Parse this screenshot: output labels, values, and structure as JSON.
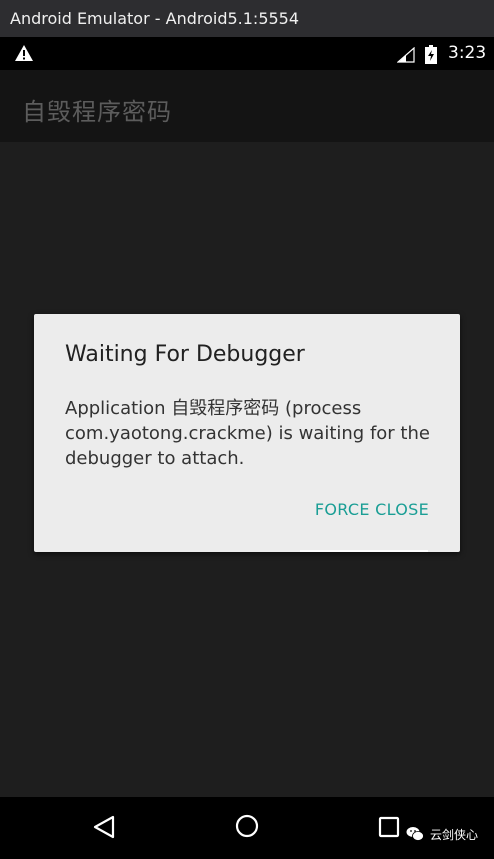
{
  "window": {
    "title": "Android Emulator - Android5.1:5554"
  },
  "status_bar": {
    "time": "3:23",
    "icons": [
      "warning-icon",
      "signal-icon",
      "battery-icon"
    ]
  },
  "app_bar": {
    "title": "自毁程序密码"
  },
  "dialog": {
    "title": "Waiting For Debugger",
    "message": "Application 自毁程序密码 (process com.yaotong.crackme) is waiting for the debugger to attach.",
    "button": "FORCE CLOSE",
    "accent_color": "#1a9e95"
  },
  "nav_bar": {
    "icons": [
      "back-icon",
      "home-icon",
      "recents-icon"
    ]
  },
  "watermark": {
    "text": "云剑侠心"
  }
}
